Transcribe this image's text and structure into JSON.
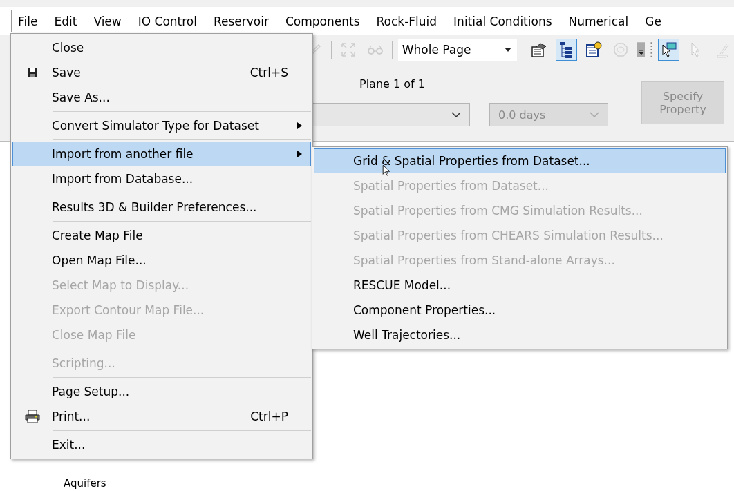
{
  "menubar": [
    {
      "label": "File",
      "selected": true
    },
    {
      "label": "Edit",
      "selected": false
    },
    {
      "label": "View",
      "selected": false
    },
    {
      "label": "IO Control",
      "selected": false
    },
    {
      "label": "Reservoir",
      "selected": false
    },
    {
      "label": "Components",
      "selected": false
    },
    {
      "label": "Rock-Fluid",
      "selected": false
    },
    {
      "label": "Initial Conditions",
      "selected": false
    },
    {
      "label": "Numerical",
      "selected": false
    },
    {
      "label": "Ge",
      "selected": false
    }
  ],
  "toolbar": {
    "left_groups": [
      [
        {
          "kind": "pencil",
          "pressed": false,
          "disabled": true
        }
      ],
      [
        {
          "kind": "expand",
          "pressed": false,
          "disabled": true
        },
        {
          "kind": "glasses",
          "pressed": false,
          "disabled": true
        }
      ]
    ],
    "zoom_combo": "Whole Page",
    "right_groups": [
      [
        {
          "kind": "properties",
          "pressed": false,
          "disabled": false
        },
        {
          "kind": "tree",
          "pressed": true,
          "disabled": false
        },
        {
          "kind": "calendar",
          "pressed": false,
          "disabled": false
        },
        {
          "kind": "octagon",
          "pressed": false,
          "disabled": true
        }
      ],
      [
        {
          "kind": "pointer-note",
          "pressed": true,
          "disabled": false
        },
        {
          "kind": "pointer",
          "pressed": false,
          "disabled": true
        },
        {
          "kind": "pen-plane",
          "pressed": false,
          "disabled": true
        }
      ]
    ]
  },
  "controls": {
    "plane_label": "Plane 1 of 1",
    "time_combo": {
      "value": "0.0 days",
      "disabled": true
    },
    "specify_button": {
      "label": "Specify Property",
      "disabled": true
    }
  },
  "tree": {
    "items": [
      "Aquifers"
    ]
  },
  "file_menu": {
    "groups": [
      [
        {
          "kind": "plain",
          "label": "Close",
          "disabled": false,
          "selected": false
        },
        {
          "kind": "save",
          "label": "Save",
          "shortcut": "Ctrl+S",
          "disabled": false,
          "selected": false
        },
        {
          "kind": "plain",
          "label": "Save As...",
          "disabled": false,
          "selected": false
        }
      ],
      [
        {
          "kind": "submenu",
          "label": "Convert Simulator Type for Dataset",
          "disabled": false,
          "selected": false
        }
      ],
      [
        {
          "kind": "submenu",
          "label": "Import from another file",
          "disabled": false,
          "selected": true
        },
        {
          "kind": "plain",
          "label": "Import from Database...",
          "disabled": false,
          "selected": false
        }
      ],
      [
        {
          "kind": "plain",
          "label": "Results 3D & Builder Preferences...",
          "disabled": false,
          "selected": false
        }
      ],
      [
        {
          "kind": "plain",
          "label": "Create Map File",
          "disabled": false,
          "selected": false
        },
        {
          "kind": "plain",
          "label": "Open Map File...",
          "disabled": false,
          "selected": false
        },
        {
          "kind": "plain",
          "label": "Select Map to Display...",
          "disabled": true,
          "selected": false
        },
        {
          "kind": "plain",
          "label": "Export Contour Map File...",
          "disabled": true,
          "selected": false
        },
        {
          "kind": "plain",
          "label": "Close Map File",
          "disabled": true,
          "selected": false
        }
      ],
      [
        {
          "kind": "plain",
          "label": "Scripting...",
          "disabled": true,
          "selected": false
        }
      ],
      [
        {
          "kind": "plain",
          "label": "Page Setup...",
          "disabled": false,
          "selected": false
        },
        {
          "kind": "print",
          "label": "Print...",
          "shortcut": "Ctrl+P",
          "disabled": false,
          "selected": false
        }
      ],
      [
        {
          "kind": "plain",
          "label": "Exit...",
          "disabled": false,
          "selected": false
        }
      ]
    ]
  },
  "import_submenu": {
    "items": [
      {
        "label": "Grid & Spatial Properties from Dataset...",
        "disabled": false,
        "selected": true
      },
      {
        "label": "Spatial Properties from Dataset...",
        "disabled": true,
        "selected": false
      },
      {
        "label": "Spatial Properties from CMG Simulation Results...",
        "disabled": true,
        "selected": false
      },
      {
        "label": "Spatial Properties from CHEARS Simulation Results...",
        "disabled": true,
        "selected": false
      },
      {
        "label": "Spatial Properties from Stand-alone Arrays...",
        "disabled": true,
        "selected": false
      },
      {
        "label": "RESCUE Model...",
        "disabled": false,
        "selected": false
      },
      {
        "label": "Component Properties...",
        "disabled": false,
        "selected": false
      },
      {
        "label": "Well Trajectories...",
        "disabled": false,
        "selected": false
      }
    ]
  }
}
